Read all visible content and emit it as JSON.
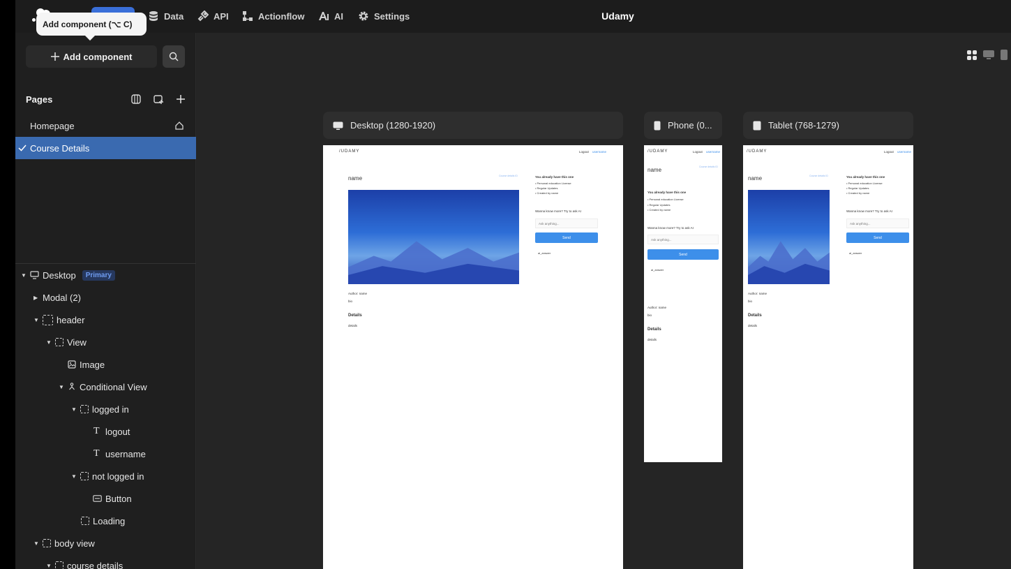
{
  "app_title": "Udamy",
  "nav": [
    {
      "label": "Data",
      "icon": "database-icon"
    },
    {
      "label": "API",
      "icon": "plug-icon"
    },
    {
      "label": "Actionflow",
      "icon": "flow-icon"
    },
    {
      "label": "AI",
      "icon": "ai-icon"
    },
    {
      "label": "Settings",
      "icon": "gear-icon"
    }
  ],
  "tooltip": "Add component (⌥ C)",
  "sidebar": {
    "add_component": "Add component",
    "pages_title": "Pages",
    "pages": [
      {
        "label": "Homepage",
        "selected": false
      },
      {
        "label": "Course Details",
        "selected": true
      }
    ],
    "tree": [
      {
        "label": "Desktop",
        "badge": "Primary"
      },
      {
        "label": "Modal (2)"
      },
      {
        "label": "header"
      },
      {
        "label": "View"
      },
      {
        "label": "Image"
      },
      {
        "label": "Conditional View"
      },
      {
        "label": "logged in"
      },
      {
        "label": "logout"
      },
      {
        "label": "username"
      },
      {
        "label": "not logged in"
      },
      {
        "label": "Button"
      },
      {
        "label": "Loading"
      },
      {
        "label": "body view"
      },
      {
        "label": "course details"
      }
    ]
  },
  "frames": [
    {
      "label": "Desktop (1280-1920)"
    },
    {
      "label": "Phone (0..."
    },
    {
      "label": "Tablet (768-1279)"
    }
  ],
  "preview": {
    "logo": "/UDAMY",
    "logout": "Logout",
    "username": "username",
    "course_name": "name",
    "side_link": "Course details ID",
    "already_have": "You already have this one",
    "bullets": [
      "• Personal education License",
      "• Regular Updates",
      "• Created by name"
    ],
    "ask_title": "Wanna know more? Try to ask AI",
    "ask_placeholder": "Ask anything...",
    "send": "Send",
    "ai_answer": "ai_answer",
    "author": "Author:  name",
    "bio": "bio",
    "details_title": "Details",
    "details": "details"
  }
}
